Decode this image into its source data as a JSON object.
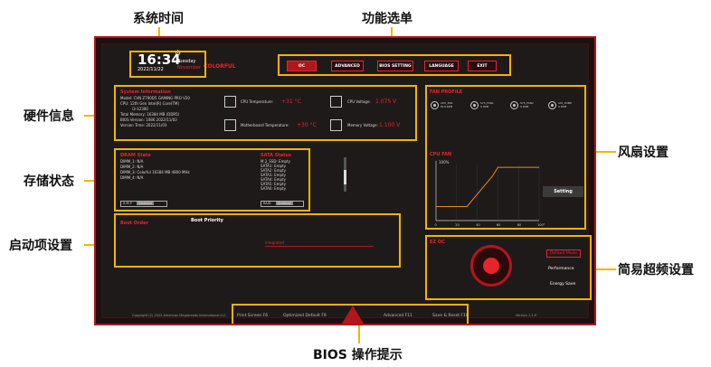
{
  "callouts": {
    "system_time": "系统时间",
    "function_menu": "功能选单",
    "hardware_info": "硬件信息",
    "storage_status": "存储状态",
    "boot_settings": "启动项设置",
    "fan_settings": "风扇设置",
    "easy_oc": "简易超频设置",
    "bios_hints": "BIOS 操作提示"
  },
  "header": {
    "time": "16:34",
    "date": "2022/11/22",
    "weekday": "Tuesday",
    "month": "November",
    "brand": "COLORFUL"
  },
  "menu": [
    "OC",
    "ADVANCED",
    "BIOS SETTING",
    "LANGUAGE",
    "EXIT"
  ],
  "system_info": {
    "title": "System Information",
    "model": "Model:  CVN Z790D5 GAMING PRO V20",
    "cpu": "CPU:  12th Gen Intel(R) Core(TM)",
    "cpu2": "i3-12300",
    "memory": "Total Memory:  16384 MB (DDR5)",
    "bios_version": "BIOS Version:  1086 2022/11/03",
    "version_time": "Version Time:  2022/11/03",
    "cpu_temp_label": "CPU Temperature:",
    "cpu_temp_value": "+31 °C",
    "cpu_voltage_label": "CPU Voltage:",
    "cpu_voltage_value": "1.075 V",
    "mb_temp_label": "Motherboard Temperature:",
    "mb_temp_value": "+30 °C",
    "mem_voltage_label": "Memory Voltage:",
    "mem_voltage_value": "1.100 V"
  },
  "dram": {
    "title": "DRAM State",
    "items": [
      "DIMM_1: N/A",
      "DIMM_2: N/A",
      "DIMM_3: Colorful 16384 MB 4800 MHz",
      "DIMM_4: N/A"
    ],
    "profile_label": "X.M.P",
    "profile_value": "Disabled"
  },
  "sata": {
    "title": "SATA Status",
    "items": [
      "M.2_SSD: Empty",
      "SATA1: Empty",
      "SATA2: Empty",
      "SATA3: Empty",
      "SATA4: Empty",
      "SATA5: Empty",
      "SATA6: Empty"
    ],
    "mode_label": "RAID",
    "mode_value": "Disabled"
  },
  "boot": {
    "title": "Boot Order",
    "priority_label": "Boot Priority",
    "device": "Integrated"
  },
  "fan": {
    "title": "FAN PROFILE",
    "fans": [
      {
        "name": "CPU_FAN",
        "rpm": "810 RPM"
      },
      {
        "name": "SYS_FAN1",
        "rpm": "0 RPM"
      },
      {
        "name": "SYS_FAN2",
        "rpm": "0 RPM"
      },
      {
        "name": "AIO_PUMP",
        "rpm": "0 RPM"
      }
    ],
    "curve_title": "CPU FAN",
    "y_max_label": "100%",
    "x_ticks": [
      "0",
      "20",
      "40",
      "60",
      "80",
      "100°C"
    ],
    "setting_button": "Setting",
    "chart_data": {
      "type": "line",
      "x": [
        0,
        20,
        30,
        55,
        60,
        80,
        100
      ],
      "y": [
        25,
        25,
        25,
        80,
        95,
        95,
        95
      ],
      "xlim": [
        0,
        100
      ],
      "ylim": [
        0,
        100
      ]
    }
  },
  "ez_oc": {
    "title": "EZ OC",
    "modes": [
      "Default Mode",
      "Performance",
      "Energy Save"
    ]
  },
  "footer": {
    "copyright": "Copyright (C) 2022 American Megatrends International LLC",
    "hints": [
      "Print Screen F6",
      "Optimized Default F9",
      "Advanced F11",
      "Save & Reset F10"
    ],
    "version": "Version 1.1.0"
  }
}
